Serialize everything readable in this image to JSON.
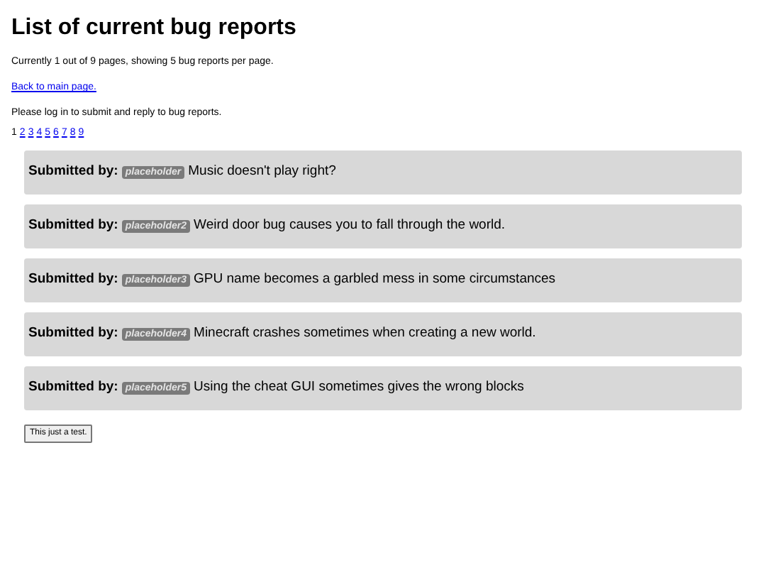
{
  "title": "List of current bug reports",
  "status_text": "Currently 1 out of 9 pages, showing 5 bug reports per page.",
  "back_link": "Back to main page.",
  "login_notice": "Please log in to submit and reply to bug reports.",
  "pages": [
    {
      "label": "1",
      "selected": true
    },
    {
      "label": "2",
      "selected": false
    },
    {
      "label": "3",
      "selected": false
    },
    {
      "label": "4",
      "selected": false
    },
    {
      "label": "5",
      "selected": false
    },
    {
      "label": "6",
      "selected": false
    },
    {
      "label": "7",
      "selected": false
    },
    {
      "label": "8",
      "selected": false
    },
    {
      "label": "9",
      "selected": false
    }
  ],
  "reports": [
    {
      "label": "Submitted by:",
      "user": "placeholder",
      "summary": "Music doesn't play right?"
    },
    {
      "label": "Submitted by:",
      "user": "placeholder2",
      "summary": "Weird door bug causes you to fall through the world."
    },
    {
      "label": "Submitted by:",
      "user": "placeholder3",
      "summary": "GPU name becomes a garbled mess in some circumstances"
    },
    {
      "label": "Submitted by:",
      "user": "placeholder4",
      "summary": "Minecraft crashes sometimes when creating a new world."
    },
    {
      "label": "Submitted by:",
      "user": "placeholder5",
      "summary": "Using the cheat GUI sometimes gives the wrong blocks"
    }
  ],
  "test_button": "This just a test."
}
